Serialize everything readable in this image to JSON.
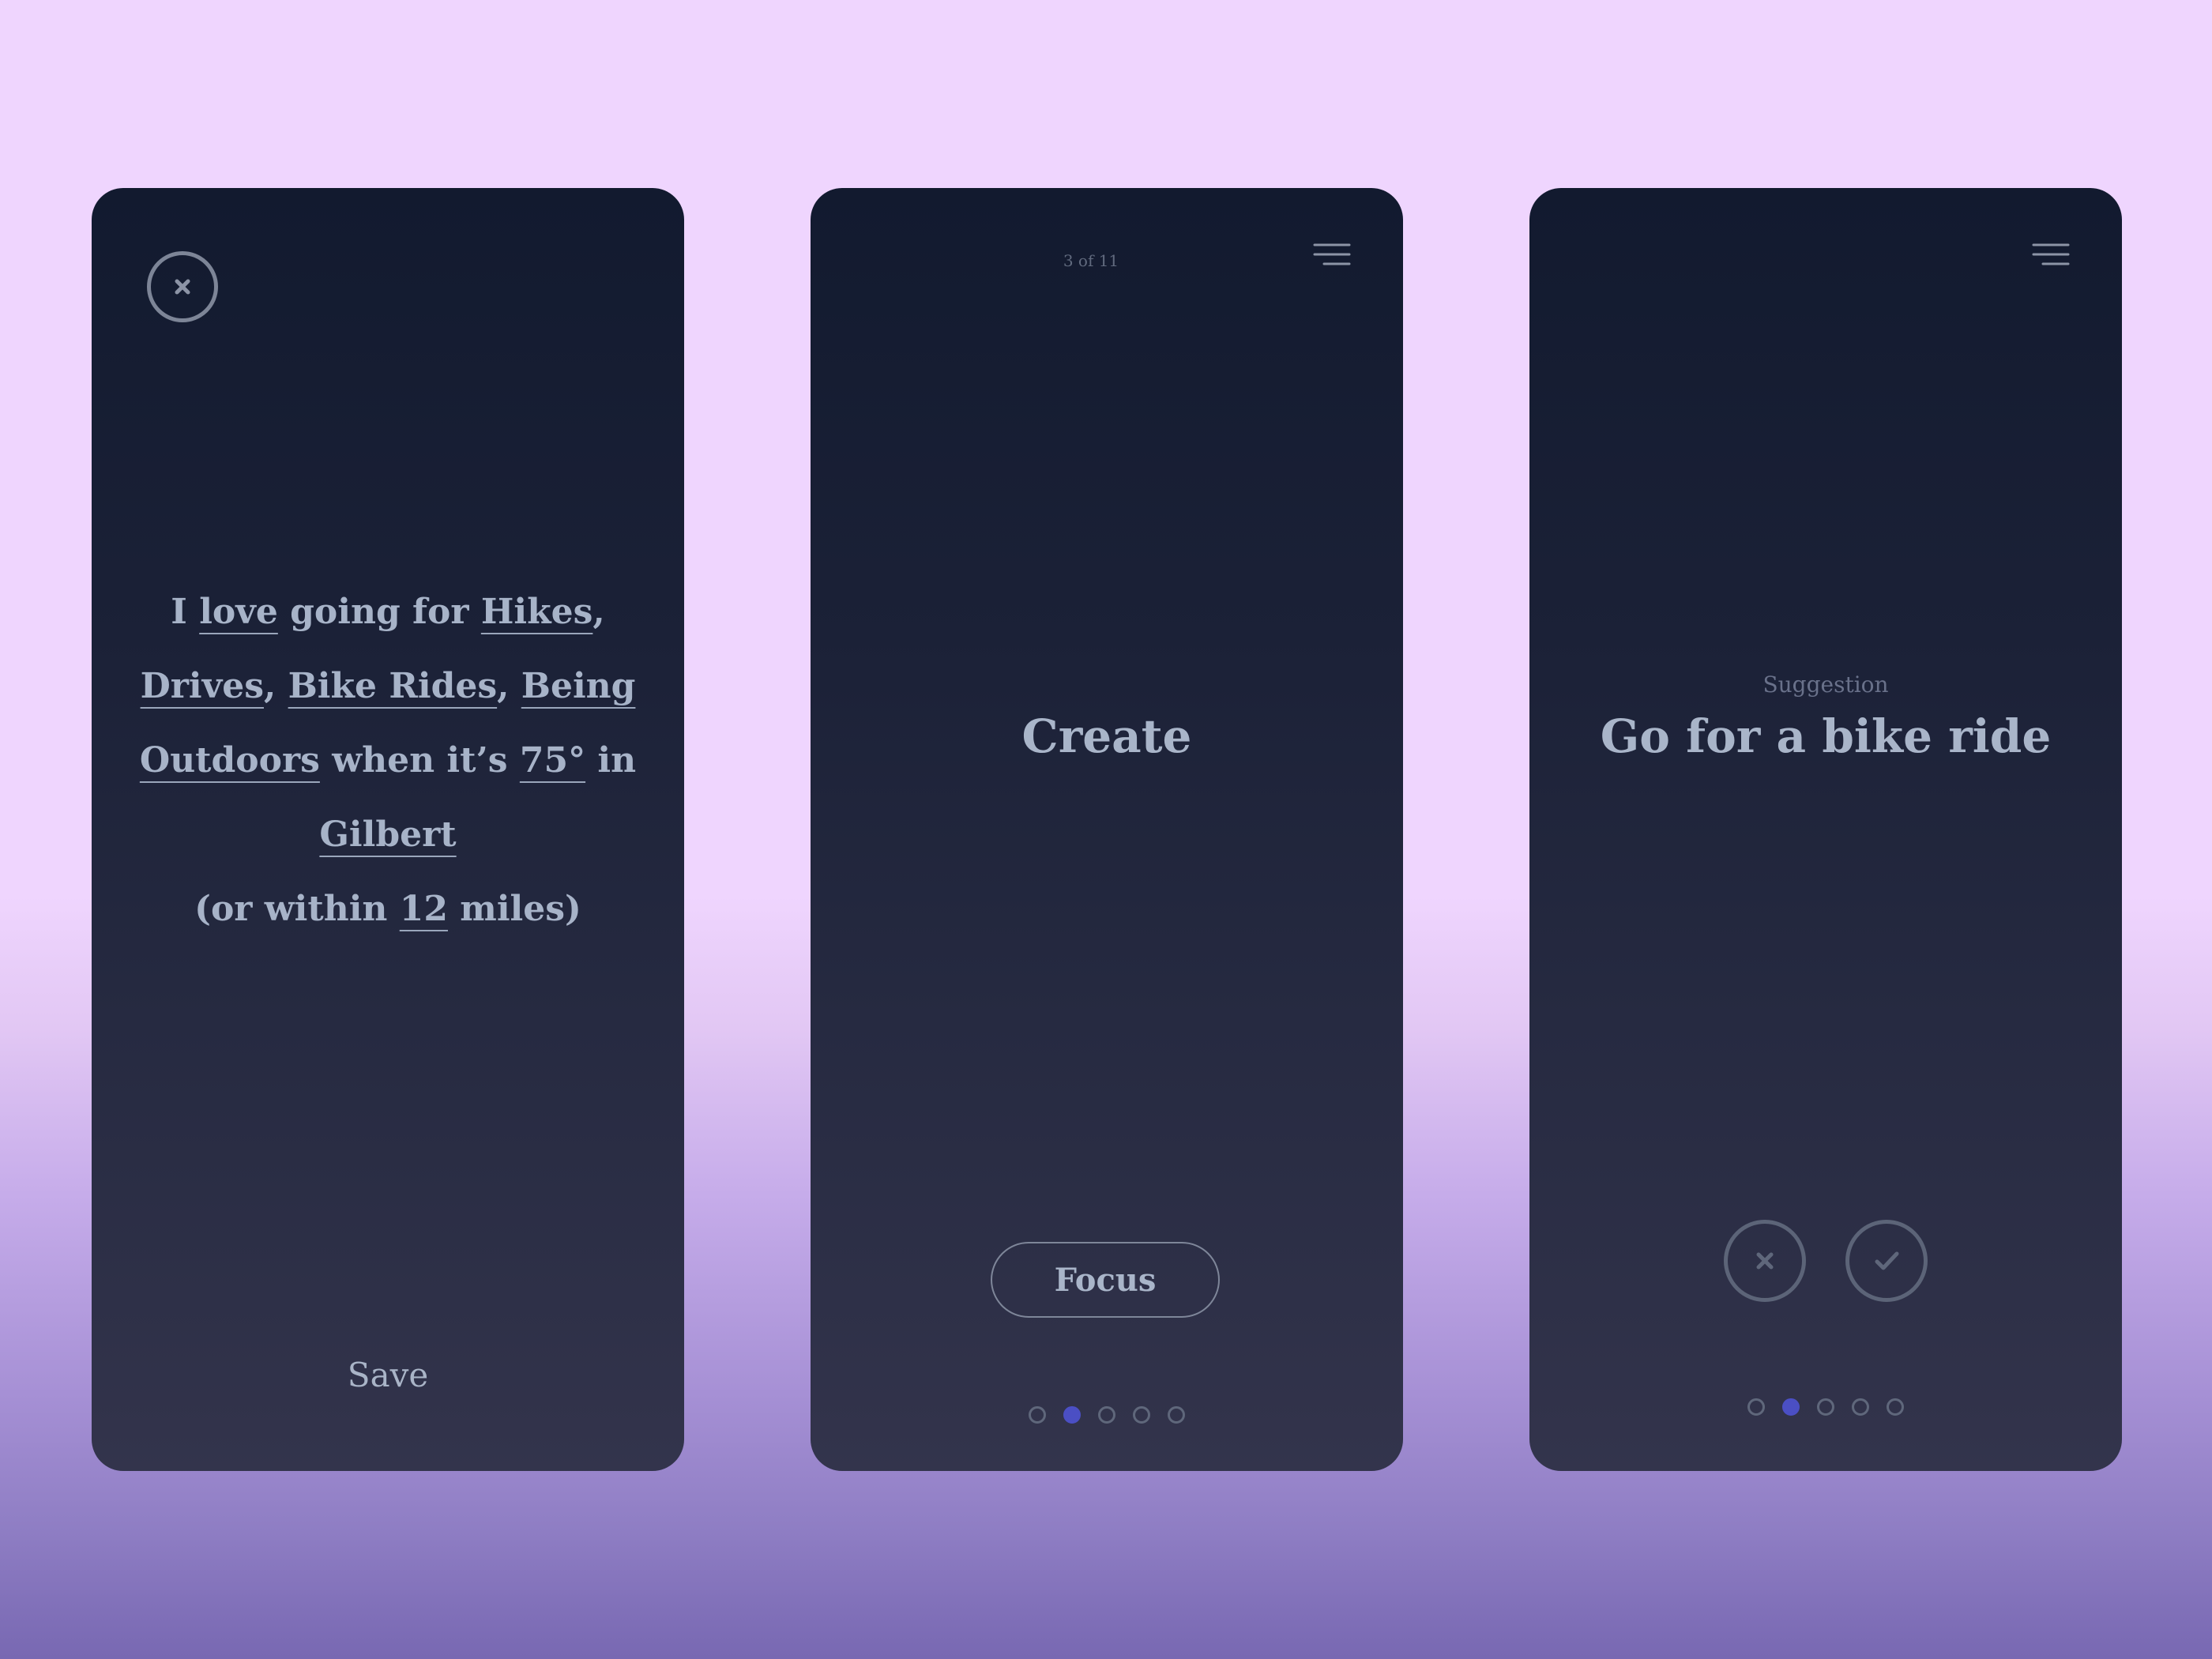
{
  "screen_1": {
    "close_icon": "close-icon",
    "statement": {
      "p1": "I ",
      "love": "love",
      "p2": " going for ",
      "hikes": "Hikes",
      "p3": ",",
      "drives": "Drives",
      "p4": ", ",
      "bike_rides": "Bike Rides",
      "p5": ", ",
      "being_outdoors": "Being Outdoors",
      "p6": "  when it’s ",
      "temperature": "75°",
      "p7": " in ",
      "city": "Gilbert",
      "p8": "(or within ",
      "distance": "12",
      "p9": " miles)"
    },
    "save_label": "Save"
  },
  "screen_2": {
    "counter": "3 of 11",
    "menu_icon": "menu-icon",
    "title": "Create",
    "focus_button": "Focus",
    "pagination": {
      "total": 5,
      "active_index": 1
    }
  },
  "screen_3": {
    "menu_icon": "menu-icon",
    "label": "Suggestion",
    "title": "Go for a bike ride",
    "reject_icon": "close-icon",
    "accept_icon": "check-icon",
    "pagination": {
      "total": 5,
      "active_index": 1
    }
  },
  "colors": {
    "background_top": "#efd5fe",
    "background_bottom": "#7868b2",
    "card_top": "#121a2f",
    "card_bottom": "#33344c",
    "text": "#a9b5c9",
    "accent": "#4b4fc4"
  }
}
